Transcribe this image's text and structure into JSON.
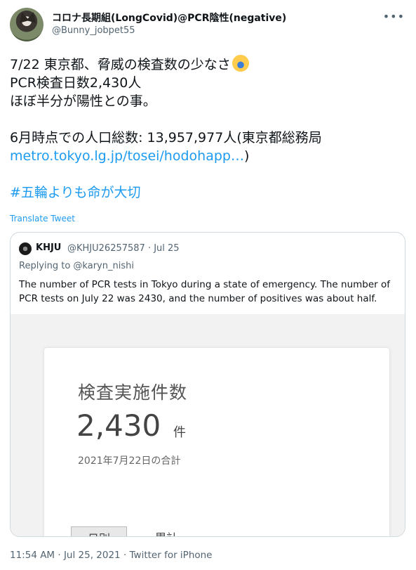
{
  "author": {
    "display_name": "コロナ長期組(LongCovid)@PCR陰性(negative)",
    "handle": "@Bunny_jobpet55",
    "more_label": "•••"
  },
  "tweet": {
    "line1": "7/22 東京都、脅威の検査数の少なさ",
    "emoji": "face-screaming-in-fear",
    "line2": "PCR検査日数2,430人",
    "line3": "ほぼ半分が陽性との事。",
    "line4": "6月時点での人口総数: 13,957,977人(東京都総務局",
    "link": "metro.tokyo.lg.jp/tosei/hodohapp…",
    "link_suffix": ")",
    "hashtag": "#五輪よりも命が大切"
  },
  "translate_label": "Translate Tweet",
  "quote": {
    "name": "KHJU",
    "handle_date": "@KHJU26257587 · Jul 25",
    "replying_to": "Replying to @karyn_nishi",
    "text": "The number of PCR tests in Tokyo during a state of emergency.  The number of PCR tests on July 22 was 2430, and the number of positives was about half.",
    "card": {
      "title": "検査実施件数",
      "value": "2,430",
      "unit": "件",
      "date": "2021年7月22日の合計",
      "tab_daily": "日別",
      "tab_cumulative": "累計"
    }
  },
  "meta": {
    "time_date": "11:54 AM · Jul 25, 2021 · ",
    "source": "Twitter for iPhone"
  }
}
